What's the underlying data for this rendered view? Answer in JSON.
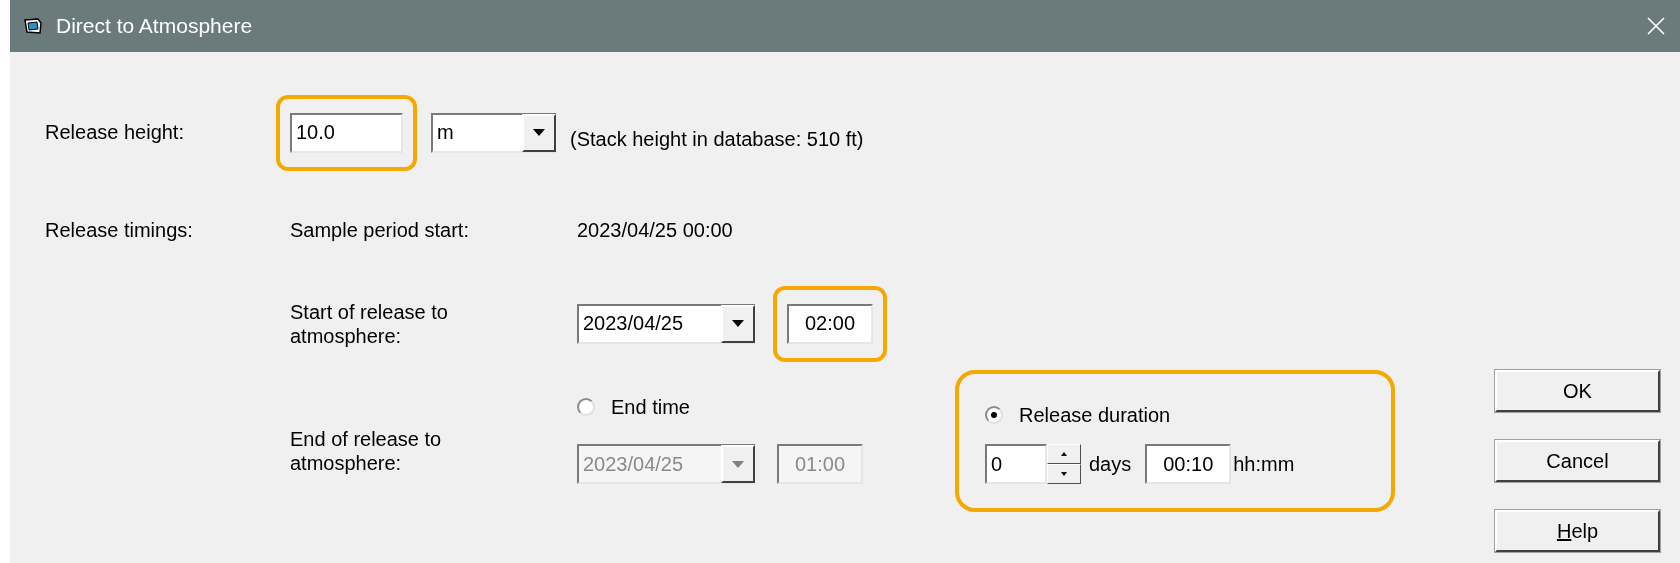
{
  "window": {
    "title": "Direct to Atmosphere"
  },
  "release_height": {
    "label": "Release height:",
    "value": "10.0",
    "highlighted": true,
    "unit": "m",
    "note": "(Stack height in database: 510 ft)"
  },
  "release_timings": {
    "label": "Release timings:",
    "sample_label": "Sample period start:",
    "sample_value": "2023/04/25 00:00"
  },
  "start": {
    "label": "Start of release to atmosphere:",
    "date": "2023/04/25",
    "time": "02:00",
    "time_highlighted": true
  },
  "end": {
    "label": "End of release to atmosphere:",
    "options": [
      {
        "kind": "end_time",
        "label": "End time",
        "selected": false,
        "highlighted": false,
        "disabled": true,
        "date": "2023/04/25",
        "time": "01:00"
      },
      {
        "kind": "duration",
        "label": "Release duration",
        "selected": true,
        "highlighted": true,
        "disabled": false,
        "days": "0",
        "days_unit": "days",
        "time": "00:10",
        "time_unit": "hh:mm"
      }
    ]
  },
  "buttons": [
    {
      "label": "OK",
      "access_key": false
    },
    {
      "label": "Cancel",
      "access_key": false
    },
    {
      "label": "Help",
      "access_key": true
    }
  ]
}
